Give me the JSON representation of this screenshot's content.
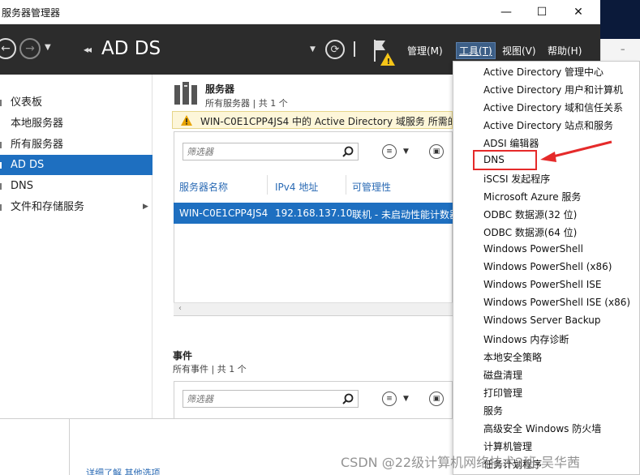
{
  "window": {
    "title": "服务器管理器",
    "minimize": "—",
    "maximize": "☐",
    "close": "✕",
    "corner_text": "–"
  },
  "header": {
    "page_title": "AD DS",
    "crumb_arrows": "◂◂",
    "menu": {
      "manage": "管理(M)",
      "tools": "工具(T)",
      "view": "视图(V)",
      "help": "帮助(H)"
    }
  },
  "sidebar": {
    "items": [
      {
        "label": "仪表板"
      },
      {
        "label": "本地服务器"
      },
      {
        "label": "所有服务器"
      },
      {
        "label": "AD DS",
        "active": true
      },
      {
        "label": "DNS"
      },
      {
        "label": "文件和存储服务",
        "expandable": true
      }
    ]
  },
  "servers": {
    "title": "服务器",
    "subtitle": "所有服务器 | 共 1 个",
    "alert": "WIN-C0E1CPP4JS4 中的 Active Directory 域服务 所需的",
    "filter_placeholder": "筛选器",
    "columns": [
      "服务器名称",
      "IPv4 地址",
      "可管理性"
    ],
    "rows": [
      {
        "name": "WIN-C0E1CPP4JS4",
        "ip": "192.168.137.10",
        "manageability": "联机 - 未启动性能计数器"
      }
    ]
  },
  "events": {
    "title": "事件",
    "subtitle": "所有事件 | 共 1 个",
    "filter_placeholder": "筛选器"
  },
  "bottom": {
    "link": "详细了解 其他选项"
  },
  "tools_menu": {
    "items": [
      "Active Directory 管理中心",
      "Active Directory 用户和计算机",
      "Active Directory 域和信任关系",
      "Active Directory 站点和服务",
      "ADSI 编辑器",
      "DNS",
      "iSCSI 发起程序",
      "Microsoft Azure 服务",
      "ODBC 数据源(32 位)",
      "ODBC 数据源(64 位)",
      "Windows PowerShell",
      "Windows PowerShell (x86)",
      "Windows PowerShell ISE",
      "Windows PowerShell ISE (x86)",
      "Windows Server Backup",
      "Windows 内存诊断",
      "本地安全策略",
      "磁盘清理",
      "打印管理",
      "服务",
      "高级安全 Windows 防火墙",
      "计算机管理",
      "任务计划程序"
    ],
    "highlighted": "DNS"
  },
  "watermark": "CSDN @22级计算机网络技术2班-吴华茜",
  "colors": {
    "header_bg": "#2c2c2c",
    "selection": "#1e6fc0",
    "highlight_box": "#e52a2a",
    "alert_bg": "#fdf6d9"
  }
}
